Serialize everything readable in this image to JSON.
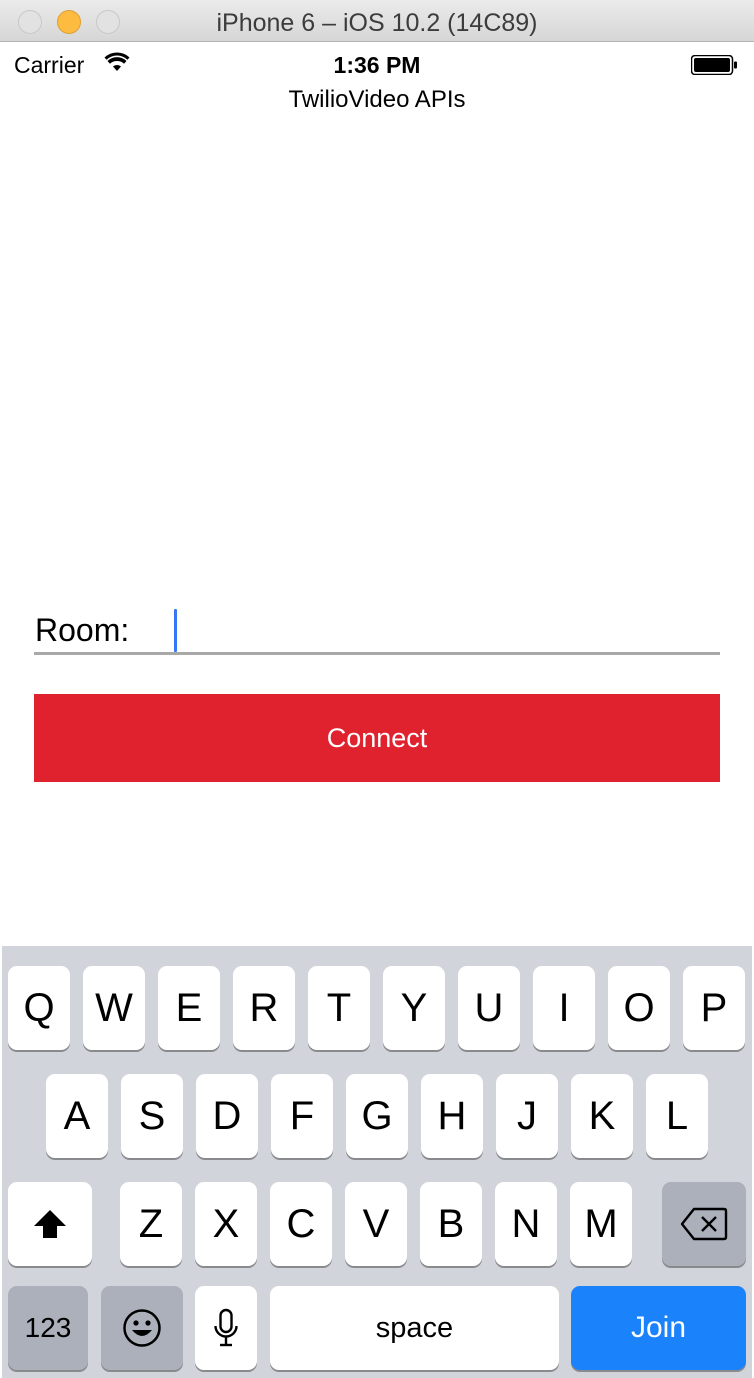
{
  "window": {
    "title": "iPhone 6 – iOS 10.2 (14C89)"
  },
  "status_bar": {
    "carrier": "Carrier",
    "time": "1:36 PM"
  },
  "nav": {
    "title": "TwilioVideo APIs"
  },
  "room": {
    "label": "Room:",
    "value": ""
  },
  "connect": {
    "label": "Connect"
  },
  "colors": {
    "connect": "#e0212e",
    "join": "#1a82fb",
    "caret": "#3478f6",
    "keyboard_bg": "#d1d4da"
  },
  "keyboard": {
    "row1": [
      "Q",
      "W",
      "E",
      "R",
      "T",
      "Y",
      "U",
      "I",
      "O",
      "P"
    ],
    "row2": [
      "A",
      "S",
      "D",
      "F",
      "G",
      "H",
      "J",
      "K",
      "L"
    ],
    "row3": [
      "Z",
      "X",
      "C",
      "V",
      "B",
      "N",
      "M"
    ],
    "numbers_label": "123",
    "space_label": "space",
    "return_label": "Join",
    "icons": {
      "shift": "shift-icon",
      "delete": "delete-icon",
      "emoji": "emoji-icon",
      "dictation": "microphone-icon"
    }
  }
}
